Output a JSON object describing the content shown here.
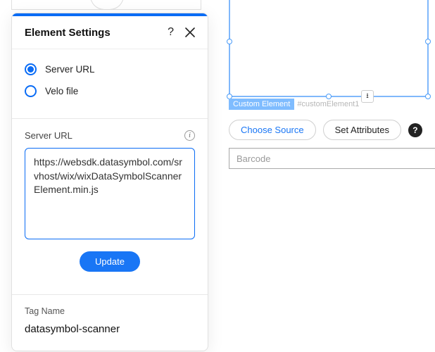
{
  "panel": {
    "title": "Element Settings",
    "radios": {
      "server_url": "Server URL",
      "velo_file": "Velo file"
    },
    "url_label": "Server URL",
    "url_value": "https://websdk.datasymbol.com/srvhost/wix/wixDataSymbolScannerElement.min.js",
    "update_label": "Update",
    "tag_label": "Tag Name",
    "tag_value": "datasymbol-scanner"
  },
  "canvas": {
    "element_type": "Custom Element",
    "element_id": "#customElement1",
    "download_glyph": "⭳"
  },
  "toolbar": {
    "choose_source": "Choose Source",
    "set_attributes": "Set Attributes",
    "help_glyph": "?"
  },
  "barcode": {
    "placeholder": "Barcode"
  }
}
